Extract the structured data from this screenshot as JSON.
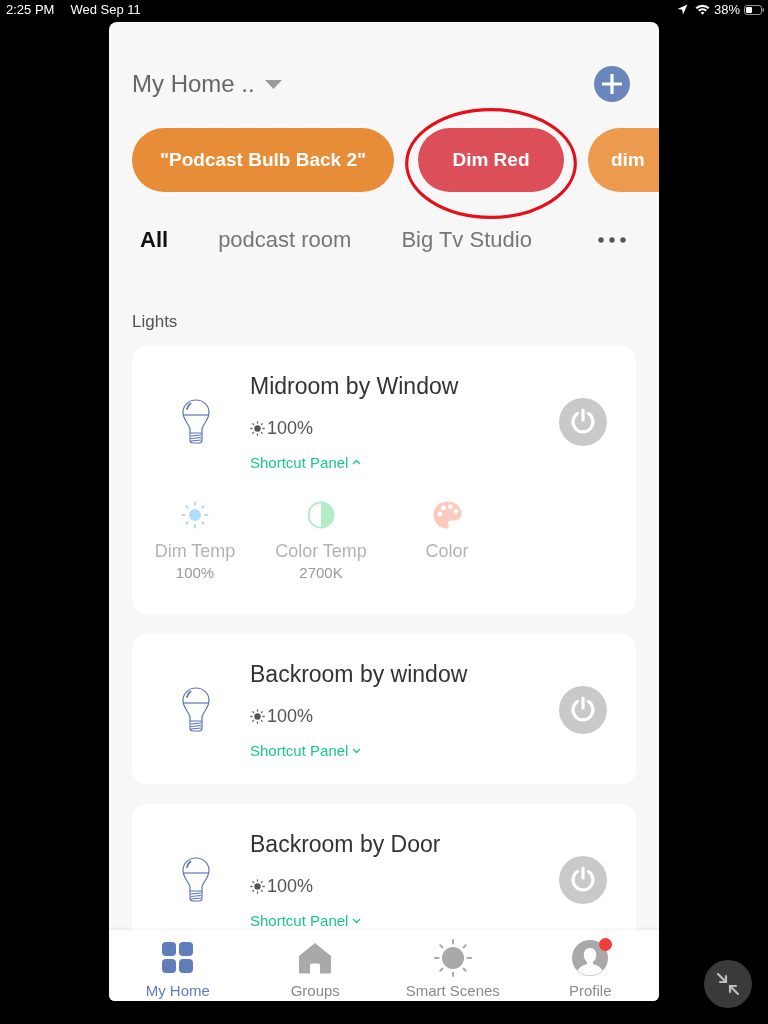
{
  "status_bar": {
    "time": "2:25 PM",
    "date": "Wed Sep 11",
    "battery": "38%"
  },
  "header": {
    "title": "My Home .."
  },
  "scenes": [
    {
      "label": "\"Podcast Bulb Back 2\"",
      "color": "#e88d37",
      "circled": false
    },
    {
      "label": "Dim Red",
      "color": "#dc4e58",
      "circled": true
    },
    {
      "label": "dim",
      "color": "#eb9a4e",
      "circled": false
    }
  ],
  "rooms": [
    {
      "label": "All",
      "selected": true
    },
    {
      "label": "podcast room",
      "selected": false
    },
    {
      "label": "Big Tv Studio",
      "selected": false
    }
  ],
  "section": {
    "title": "Lights"
  },
  "devices": [
    {
      "name": "Midroom by Window",
      "brightness": "100%",
      "shortcut_label": "Shortcut Panel",
      "expanded": true,
      "on": false,
      "shortcuts": [
        {
          "kind": "dimmer",
          "label": "Dim Temp",
          "value": "100%"
        },
        {
          "kind": "color_temp",
          "label": "Color Temp",
          "value": "2700K"
        },
        {
          "kind": "color",
          "label": "Color"
        }
      ]
    },
    {
      "name": "Backroom by window",
      "brightness": "100%",
      "shortcut_label": "Shortcut Panel",
      "expanded": false,
      "on": false
    },
    {
      "name": "Backroom by Door",
      "brightness": "100%",
      "shortcut_label": "Shortcut Panel",
      "expanded": false,
      "on": false
    }
  ],
  "tab_bar": [
    {
      "kind": "home",
      "label": "My Home",
      "selected": true,
      "badge": false
    },
    {
      "kind": "groups",
      "label": "Groups",
      "selected": false,
      "badge": false
    },
    {
      "kind": "scenes",
      "label": "Smart Scenes",
      "selected": false,
      "badge": false
    },
    {
      "kind": "profile",
      "label": "Profile",
      "selected": false,
      "badge": true
    }
  ]
}
